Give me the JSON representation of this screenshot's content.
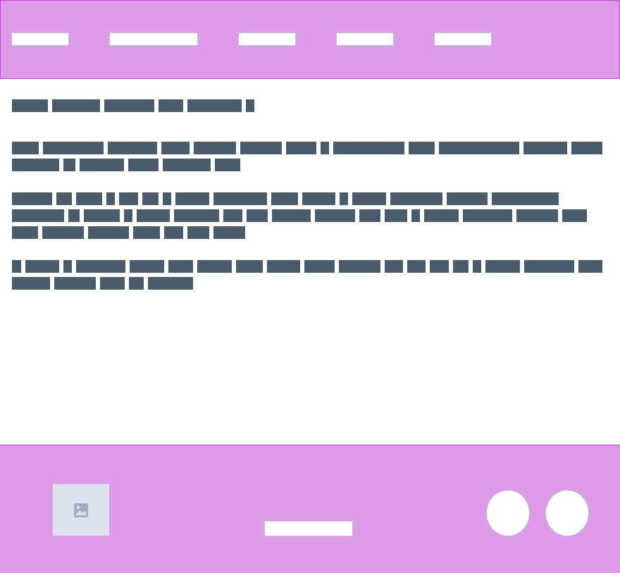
{
  "header": {
    "nav": [
      {
        "label": ""
      },
      {
        "label": ""
      },
      {
        "label": ""
      },
      {
        "label": ""
      },
      {
        "label": ""
      }
    ]
  },
  "main": {
    "title": "",
    "paragraphs": [
      "",
      "",
      ""
    ]
  },
  "footer": {
    "image_icon": "image-icon",
    "link_label": "",
    "buttons": [
      {
        "icon": "circle-button"
      },
      {
        "icon": "circle-button"
      }
    ]
  },
  "colors": {
    "header_bg": "#dd9be9",
    "border_accent": "#c83fd6",
    "text_placeholder": "#4a5b6b",
    "control_border": "#b9bfd0"
  }
}
